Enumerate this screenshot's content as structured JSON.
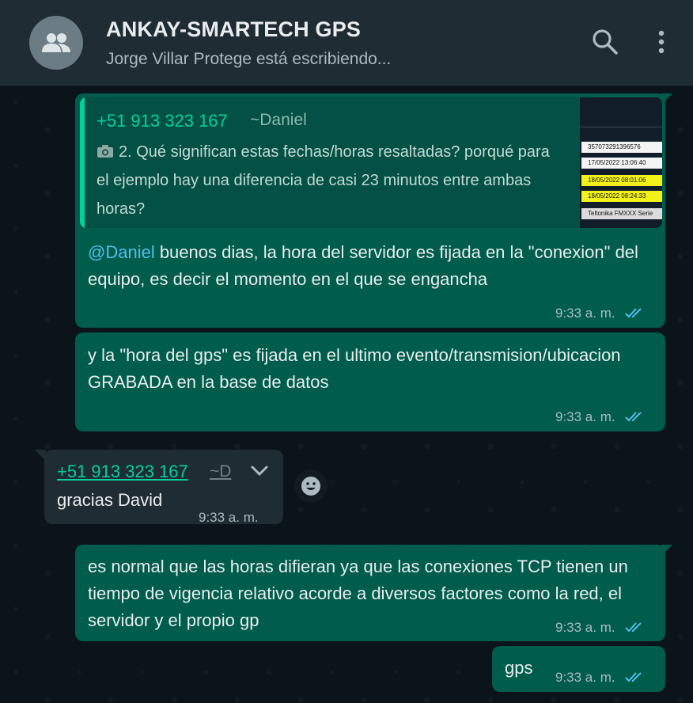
{
  "header": {
    "title": "ANKAY-SMARTECH GPS",
    "subtitle": "Jorge Villar Protege está escribiendo...",
    "avatar_icon": "group-icon",
    "search_icon": "search-icon",
    "menu_icon": "more-vert-icon"
  },
  "colors": {
    "outgoing_bubble": "#005c4b",
    "incoming_bubble": "#202c33",
    "accent_green": "#06cf9c",
    "mention_blue": "#53bdeb",
    "read_ticks": "#53bdeb"
  },
  "messages": [
    {
      "direction": "out",
      "quote": {
        "phone": "+51 913 323 167",
        "name": "~Daniel",
        "text": "2. Qué significan estas fechas/horas resaltadas? porqué para el ejemplo hay una diferencia de casi 23 minutos entre ambas horas?",
        "media_icon": "camera-icon",
        "thumbnail_rows": [
          "357073291396576",
          "17/05/2022 13:06:40",
          "18/05/2022 08:01:06",
          "18/05/2022 08:24:33",
          "Teltonika FMXXX Serie"
        ]
      },
      "mention": "@Daniel",
      "text": " buenos dias, la hora del servidor es fijada en la \"conexion\" del equipo, es decir el momento en el que se engancha",
      "time": "9:33 a. m."
    },
    {
      "direction": "out",
      "text": "y la \"hora del gps\" es fijada en el ultimo evento/transmision/ubicacion GRABADA en la base de datos",
      "time": "9:33 a. m."
    },
    {
      "direction": "in",
      "sender_phone": "+51 913 323 167",
      "sender_name": "~D",
      "text": "gracias David",
      "time": "9:33 a. m."
    },
    {
      "direction": "out",
      "text": "es normal que las horas difieran ya que las conexiones TCP tienen un tiempo de vigencia relativo acorde a diversos factores como la red, el servidor y el propio gp",
      "time": "9:33 a. m."
    },
    {
      "direction": "out",
      "text": "gps",
      "time": "9:33 a. m."
    }
  ]
}
